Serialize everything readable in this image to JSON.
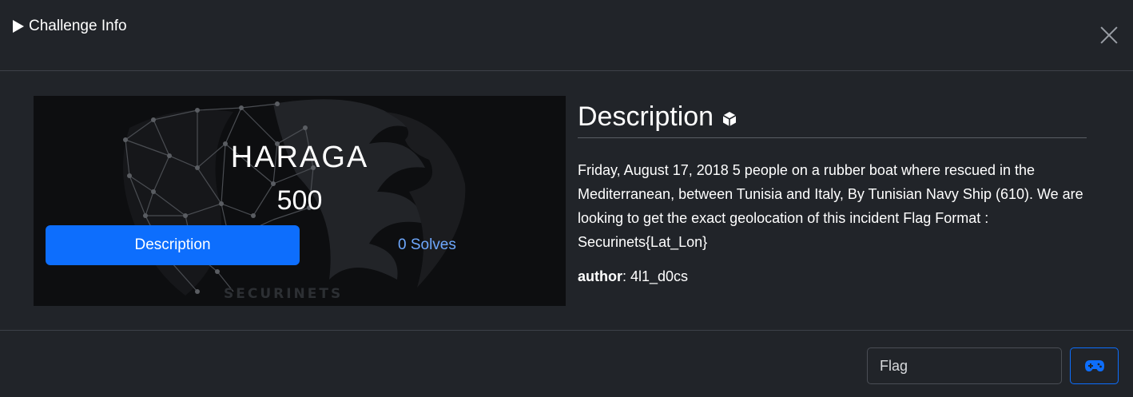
{
  "header": {
    "title": "Challenge Info"
  },
  "challenge": {
    "name": "HARAGA",
    "points": "500",
    "brand": "SECURINETS"
  },
  "tabs": {
    "description_label": "Description",
    "solves_label": "0 Solves"
  },
  "description": {
    "heading": "Description",
    "text": "Friday, August 17, 2018 5 people on a rubber boat where rescued in the Mediterranean, between Tunisia and Italy, By Tunisian Navy Ship (610). We are looking to get the exact geolocation of this incident Flag Format : Securinets{Lat_Lon}",
    "author_label": "author",
    "author_value": ": 4l1_d0cs"
  },
  "footer": {
    "flag_placeholder": "Flag"
  },
  "icons": {
    "header": "play-icon",
    "close": "close-icon",
    "heading": "cube-icon",
    "submit": "gamepad-icon"
  },
  "colors": {
    "background": "#212429",
    "accent": "#0d6efd",
    "link": "#6ea8fe"
  }
}
